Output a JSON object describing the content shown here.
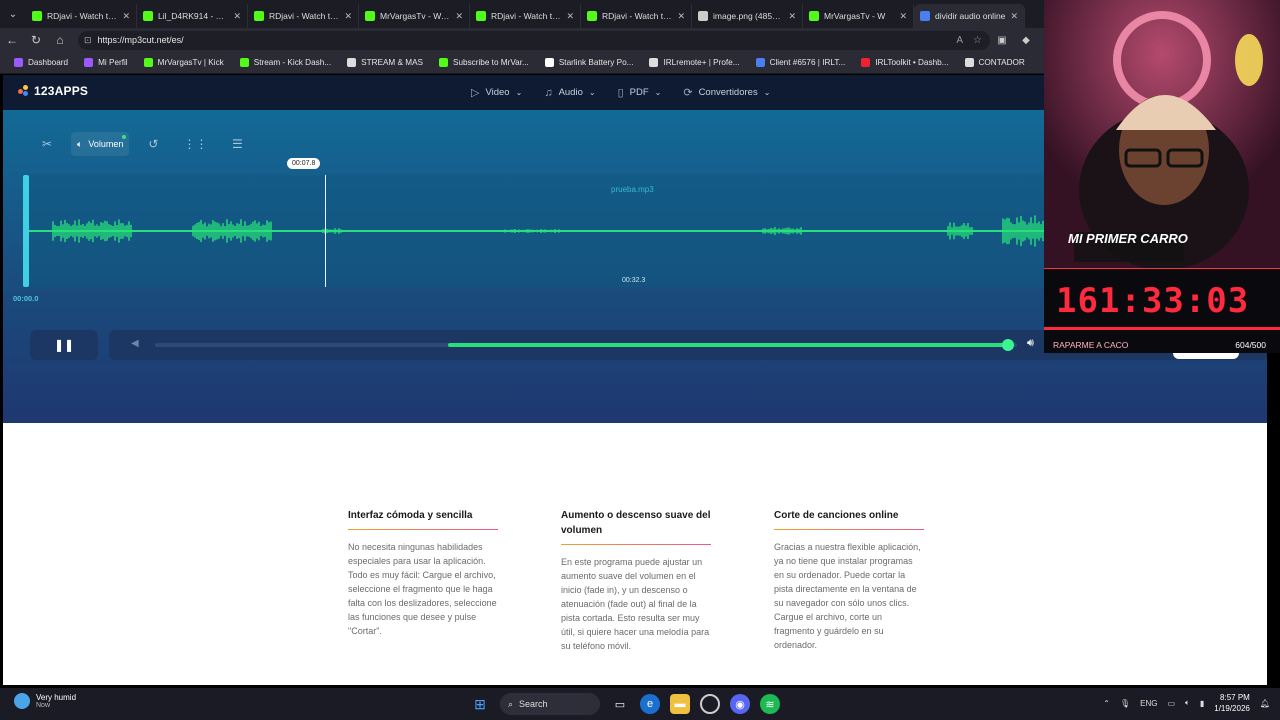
{
  "browser": {
    "tabs": [
      {
        "title": "RDjavi - Watch the V",
        "color": "#53fc18"
      },
      {
        "title": "Lil_D4RK914 - Watch",
        "color": "#53fc18"
      },
      {
        "title": "RDjavi - Watch the V",
        "color": "#53fc18"
      },
      {
        "title": "MrVargasTv - Watch",
        "color": "#53fc18"
      },
      {
        "title": "RDjavi - Watch the V",
        "color": "#53fc18"
      },
      {
        "title": "RDjavi - Watch the V",
        "color": "#53fc18"
      },
      {
        "title": "image.png (485×52)",
        "color": "#cccccc"
      },
      {
        "title": "MrVargasTv - W",
        "color": "#53fc18"
      },
      {
        "title": "dividir audio online",
        "color": "#4a7ff0"
      }
    ],
    "url": "https://mp3cut.net/es/",
    "bookmarks": [
      {
        "label": "Dashboard",
        "color": "#9b59ff"
      },
      {
        "label": "Mi Perfil",
        "color": "#9b59ff"
      },
      {
        "label": "MrVargasTv | Kick",
        "color": "#53fc18"
      },
      {
        "label": "Stream - Kick Dash...",
        "color": "#53fc18"
      },
      {
        "label": "STREAM & MAS",
        "color": "#dddddd"
      },
      {
        "label": "Subscribe to MrVar...",
        "color": "#53fc18"
      },
      {
        "label": "Starlink Battery Po...",
        "color": "#ffffff"
      },
      {
        "label": "IRLremote+ | Profe...",
        "color": "#dddddd"
      },
      {
        "label": "Client #6576 | IRLT...",
        "color": "#4a7ff0"
      },
      {
        "label": "IRLToolkit • Dashb...",
        "color": "#e23"
      },
      {
        "label": "CONTADOR",
        "color": "#dddddd"
      }
    ]
  },
  "site": {
    "logo": "123APPS",
    "nav": [
      {
        "label": "Video",
        "icon": "video-icon",
        "glyph": "▷"
      },
      {
        "label": "Audio",
        "icon": "music-icon",
        "glyph": "♫"
      },
      {
        "label": "PDF",
        "icon": "document-icon",
        "glyph": "▯"
      },
      {
        "label": "Convertidores",
        "icon": "convert-icon",
        "glyph": "⟳"
      }
    ],
    "editor": {
      "active_tool": "Volumen",
      "track_name": "prueba.mp3",
      "playhead_time": "00:07.8",
      "start_time": "00:00.0",
      "mid_time": "00:32.3",
      "volume_fraction": 0.99,
      "volume_start_fraction": 0.34
    },
    "features": [
      {
        "title": "Interfaz cómoda y sencilla",
        "text": "No necesita ningunas habilidades especiales para usar la aplicación. Todo es muy fácil: Cargue el archivo, seleccione el fragmento que le haga falta con los deslizadores, seleccione las funciones que desee y pulse \"Cortar\"."
      },
      {
        "title": "Aumento o descenso suave del volumen",
        "text": "En este programa puede ajustar un aumento suave del volumen en el inicio (fade in), y un descenso o atenuación (fade out) al final de la pista cortada. Esto resulta ser muy útil, si quiere hacer una melodía para su teléfono móvil."
      },
      {
        "title": "Corte de canciones online",
        "text": "Gracias a nuestra flexible aplicación, ya no tiene que instalar programas en su ordenador. Puede cortar la pista directamente en la ventana de su navegador con sólo unos clics. Cargue el archivo, corte un fragmento y guárdelo en su ordenador."
      }
    ]
  },
  "overlay": {
    "banner": "MI PRIMER CARRO",
    "timer": "161:33:03",
    "label": "RAPARME A CACO",
    "count": "604/500"
  },
  "taskbar": {
    "weather": "Very humid",
    "weather_sub": "Now",
    "search": "Search",
    "lang": "ENG",
    "time": "8:57 PM",
    "date": "1/19/2026"
  },
  "colors": {
    "wave": "#27e07a",
    "accent": "#3ee08a",
    "timer_red": "#ff2a3e"
  }
}
